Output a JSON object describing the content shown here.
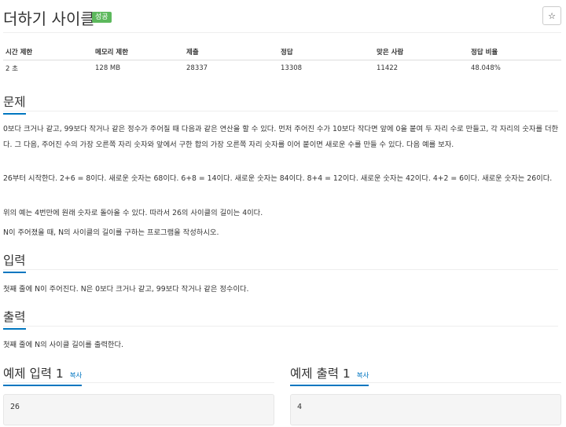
{
  "problem": {
    "title": "더하기 사이클",
    "badge": "성공",
    "star_icon": "☆"
  },
  "stats": {
    "headers": [
      "시간 제한",
      "메모리 제한",
      "제출",
      "정답",
      "맞은 사람",
      "정답 비율"
    ],
    "values": [
      "2 초",
      "128 MB",
      "28337",
      "13308",
      "11422",
      "48.048%"
    ]
  },
  "sections": {
    "description_title": "문제",
    "description_p1": "0보다 크거나 같고, 99보다 작거나 같은 정수가 주어질 때 다음과 같은 연산을 할 수 있다. 먼저 주어진 수가 10보다 작다면 앞에 0을 붙여 두 자리 수로 만들고, 각 자리의 숫자를 더한다. 그 다음, 주어진 수의 가장 오른쪽 자리 숫자와 앞에서 구한 합의 가장 오른쪽 자리 숫자를 이어 붙이면 새로운 수를 만들 수 있다. 다음 예를 보자.",
    "description_p2": "26부터 시작한다. 2+6 = 8이다. 새로운 숫자는 68이다. 6+8 = 14이다. 새로운 숫자는 84이다. 8+4 = 12이다. 새로운 숫자는 42이다. 4+2 = 6이다. 새로운 숫자는 26이다.",
    "description_p3": "위의 예는 4번만에 원래 숫자로 돌아올 수 있다. 따라서 26의 사이클의 길이는 4이다.",
    "description_p4": "N이 주어졌을 때, N의 사이클의 길이를 구하는 프로그램을 작성하시오.",
    "input_title": "입력",
    "input_text": "첫째 줄에 N이 주어진다. N은 0보다 크거나 같고, 99보다 작거나 같은 정수이다.",
    "output_title": "출력",
    "output_text": "첫째 줄에 N의 사이클 길이를 출력한다."
  },
  "samples": {
    "input_title": "예제 입력 1",
    "output_title": "예제 출력 1",
    "copy_label": "복사",
    "input_value": "26",
    "output_value": "4"
  }
}
